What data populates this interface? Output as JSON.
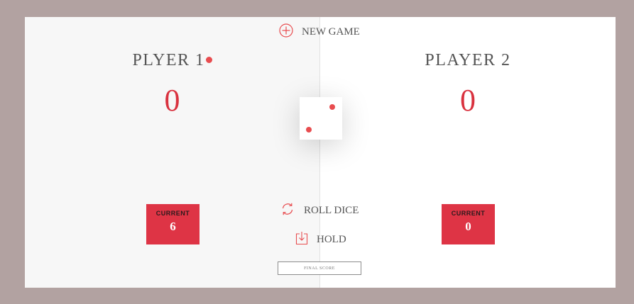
{
  "players": [
    {
      "name": "PLYER 1",
      "score": "0",
      "current_label": "CURRENT",
      "current": "6",
      "active": true
    },
    {
      "name": "PLAYER 2",
      "score": "0",
      "current_label": "CURRENT",
      "current": "0",
      "active": false
    }
  ],
  "controls": {
    "new_game_label": "NEW GAME",
    "new_game_icon": "plus-circle-icon",
    "roll_dice_label": "ROLL DICE",
    "roll_dice_icon": "refresh-icon",
    "hold_label": "HOLD",
    "hold_icon": "download-icon"
  },
  "dice": {
    "value": 2
  },
  "final_score": {
    "placeholder": "FINAL SCORE",
    "value": ""
  },
  "colors": {
    "accent": "#e84c4f",
    "score_red": "#d9323f",
    "current_box": "#de3445",
    "background": "#b2a2a1",
    "panel_active": "#f7f7f7",
    "panel_inactive": "#ffffff",
    "text": "#555555"
  }
}
